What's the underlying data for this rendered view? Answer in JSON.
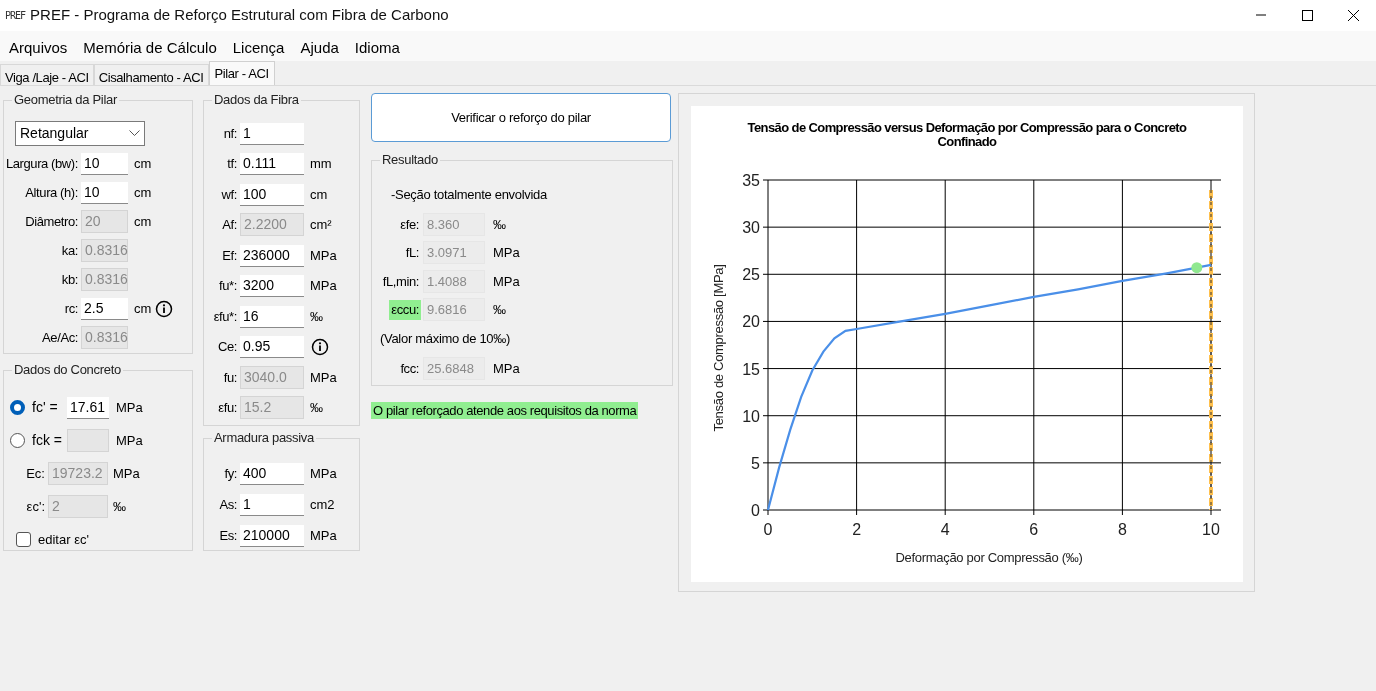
{
  "window": {
    "icon_label": "PREF",
    "title": "PREF - Programa de Reforço Estrutural com Fibra de Carbono"
  },
  "menu": [
    "Arquivos",
    "Memória de Cálculo",
    "Licença",
    "Ajuda",
    "Idioma"
  ],
  "tabs": [
    {
      "label": "Viga /Laje - ACI",
      "selected": false
    },
    {
      "label": "Cisalhamento - ACI",
      "selected": false
    },
    {
      "label": "Pilar - ACI",
      "selected": true
    }
  ],
  "geometry": {
    "title": "Geometria da Pilar",
    "shape": "Retangular",
    "rows": [
      {
        "label": "Largura (bw):",
        "value": "10",
        "unit": "cm",
        "disabled": false,
        "info": false
      },
      {
        "label": "Altura (h):",
        "value": "10",
        "unit": "cm",
        "disabled": false,
        "info": false
      },
      {
        "label": "Diâmetro:",
        "value": "20",
        "unit": "cm",
        "disabled": true,
        "info": false
      },
      {
        "label": "ka:",
        "value": "0.8316",
        "disabled": true,
        "info": false
      },
      {
        "label": "kb:",
        "value": "0.8316",
        "disabled": true,
        "info": false
      },
      {
        "label": "rc:",
        "value": "2.5",
        "unit": "cm",
        "disabled": false,
        "info": true
      },
      {
        "label": "Ae/Ac:",
        "value": "0.8316",
        "disabled": true,
        "info": false
      }
    ]
  },
  "concrete": {
    "title": "Dados do Concreto",
    "rows": [
      {
        "kind": "radio",
        "label": "fc' =",
        "value": "17.61",
        "unit": "MPa",
        "selected": true,
        "disabled": false
      },
      {
        "kind": "radio",
        "label": "fck =",
        "unit": "MPa",
        "selected": false,
        "disabled": true
      },
      {
        "kind": "field",
        "label": "Ec:",
        "value": "19723.2",
        "unit": "MPa",
        "disabled": true
      },
      {
        "kind": "field",
        "label": "εc':",
        "value": "2",
        "unit": "‰",
        "disabled": true
      },
      {
        "kind": "checkbox",
        "label": "editar εc'",
        "checked": false
      }
    ]
  },
  "fiber": {
    "title": "Dados da Fibra",
    "rows": [
      {
        "label": "nf:",
        "value": "1",
        "disabled": false,
        "info": false
      },
      {
        "label": "tf:",
        "value": "0.111",
        "unit": "mm",
        "disabled": false,
        "info": false
      },
      {
        "label": "wf:",
        "value": "100",
        "unit": "cm",
        "disabled": false,
        "info": false
      },
      {
        "label": "Af:",
        "value": "2.2200",
        "unit": "cm²",
        "disabled": true,
        "info": false
      },
      {
        "label": "Ef:",
        "value": "236000",
        "unit": "MPa",
        "disabled": false,
        "info": false
      },
      {
        "label": "fu*:",
        "value": "3200",
        "unit": "MPa",
        "disabled": false,
        "info": false
      },
      {
        "label": "εfu*:",
        "value": "16",
        "unit": "‰",
        "disabled": false,
        "info": false
      },
      {
        "label": "Ce:",
        "value": "0.95",
        "disabled": false,
        "info": true
      },
      {
        "label": "fu:",
        "value": "3040.0",
        "unit": "MPa",
        "disabled": true,
        "info": false
      },
      {
        "label": "εfu:",
        "value": "15.2",
        "unit": "‰",
        "disabled": true,
        "info": false
      }
    ]
  },
  "reinforcement": {
    "title": "Armadura passiva",
    "rows": [
      {
        "label": "fy:",
        "value": "400",
        "unit": "MPa",
        "disabled": false,
        "info": false
      },
      {
        "label": "As:",
        "value": "1",
        "unit": "cm2",
        "disabled": false,
        "info": false
      },
      {
        "label": "Es:",
        "value": "210000",
        "unit": "MPa",
        "disabled": false,
        "info": false
      }
    ]
  },
  "verify_button": "Verificar o reforço do pilar",
  "result": {
    "title": "Resultado",
    "items": [
      {
        "kind": "note",
        "text": "-Seção totalmente envolvida"
      },
      {
        "kind": "row",
        "label": "εfe:",
        "value": "8.360",
        "unit": "‰",
        "highlighted": false
      },
      {
        "kind": "row",
        "label": "fL:",
        "value": "3.0971",
        "unit": "MPa",
        "highlighted": false
      },
      {
        "kind": "row",
        "label": "fL,min:",
        "value": "1.4088",
        "unit": "MPa",
        "highlighted": false
      },
      {
        "kind": "row",
        "label": "εccu:",
        "value": "9.6816",
        "unit": "‰",
        "highlighted": true
      },
      {
        "kind": "note",
        "text": "(Valor máximo de 10‰)"
      },
      {
        "kind": "row",
        "label": "fcc:",
        "value": "25.6848",
        "unit": "MPa",
        "highlighted": false
      }
    ]
  },
  "status_message": "O pilar reforçado atende aos requisitos da norma",
  "chart": {
    "chart_data": {
      "type": "line",
      "title": "Tensão de Compressão versus Deformação por Compressão para o Concreto Confinado",
      "xlabel": "Deformação por Compressão (‰)",
      "ylabel": "Tensão de Compressão [MPa]",
      "x": [
        0,
        0.25,
        0.5,
        0.75,
        1,
        1.25,
        1.5,
        1.75,
        2,
        3,
        4,
        5,
        6,
        7,
        8,
        9,
        9.68,
        10
      ],
      "series": [
        {
          "color": "#4a8fe8",
          "marker": false,
          "values": [
            0,
            4.5,
            8.5,
            12,
            14.8,
            16.8,
            18.2,
            19,
            19.2,
            20,
            20.8,
            21.7,
            22.6,
            23.4,
            24.3,
            25.1,
            25.7,
            26
          ]
        },
        {
          "color": "#90e890",
          "marker": true,
          "values": [
            null,
            null,
            null,
            null,
            null,
            null,
            null,
            null,
            null,
            null,
            null,
            null,
            null,
            null,
            null,
            null,
            25.7,
            null
          ]
        }
      ],
      "grid": true,
      "xlim": [
        0,
        10
      ],
      "ylim": [
        0,
        35
      ],
      "xticks": [
        0,
        2,
        4,
        6,
        8,
        10
      ],
      "yticks": [
        0,
        5,
        10,
        15,
        20,
        25,
        30,
        35
      ],
      "ref_lines": [
        {
          "axis": "x",
          "value": 10
        }
      ]
    }
  }
}
